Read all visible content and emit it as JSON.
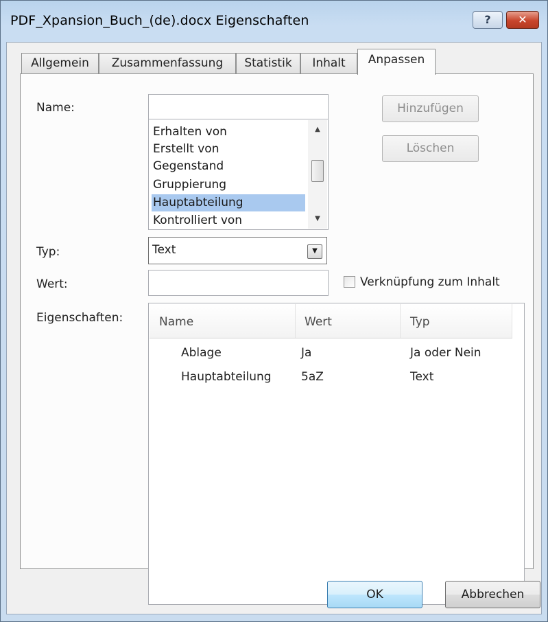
{
  "window": {
    "title": "PDF_Xpansion_Buch_(de).docx Eigenschaften",
    "help_icon": "?",
    "close_icon": "✕"
  },
  "tabs": [
    {
      "label": "Allgemein"
    },
    {
      "label": "Zusammenfassung"
    },
    {
      "label": "Statistik"
    },
    {
      "label": "Inhalt"
    },
    {
      "label": "Anpassen",
      "active": true
    }
  ],
  "form": {
    "name_label": "Name:",
    "name_value": "",
    "add_button": "Hinzufügen",
    "delete_button": "Löschen",
    "name_list": [
      "Erhalten von",
      "Erstellt von",
      "Gegenstand",
      "Gruppierung",
      "Hauptabteilung",
      "Kontrolliert von"
    ],
    "name_list_selected": "Hauptabteilung",
    "type_label": "Typ:",
    "type_value": "Text",
    "value_label": "Wert:",
    "value_value": "",
    "link_checkbox_label": "Verknüpfung zum Inhalt",
    "link_checked": false,
    "properties_label": "Eigenschaften:"
  },
  "properties_table": {
    "columns": [
      "Name",
      "Wert",
      "Typ"
    ],
    "rows": [
      {
        "name": "Ablage",
        "wert": "Ja",
        "typ": "Ja oder Nein"
      },
      {
        "name": "Hauptabteilung",
        "wert": "5aZ",
        "typ": "Text"
      }
    ]
  },
  "footer": {
    "ok_button": "OK",
    "cancel_button": "Abbrechen"
  }
}
